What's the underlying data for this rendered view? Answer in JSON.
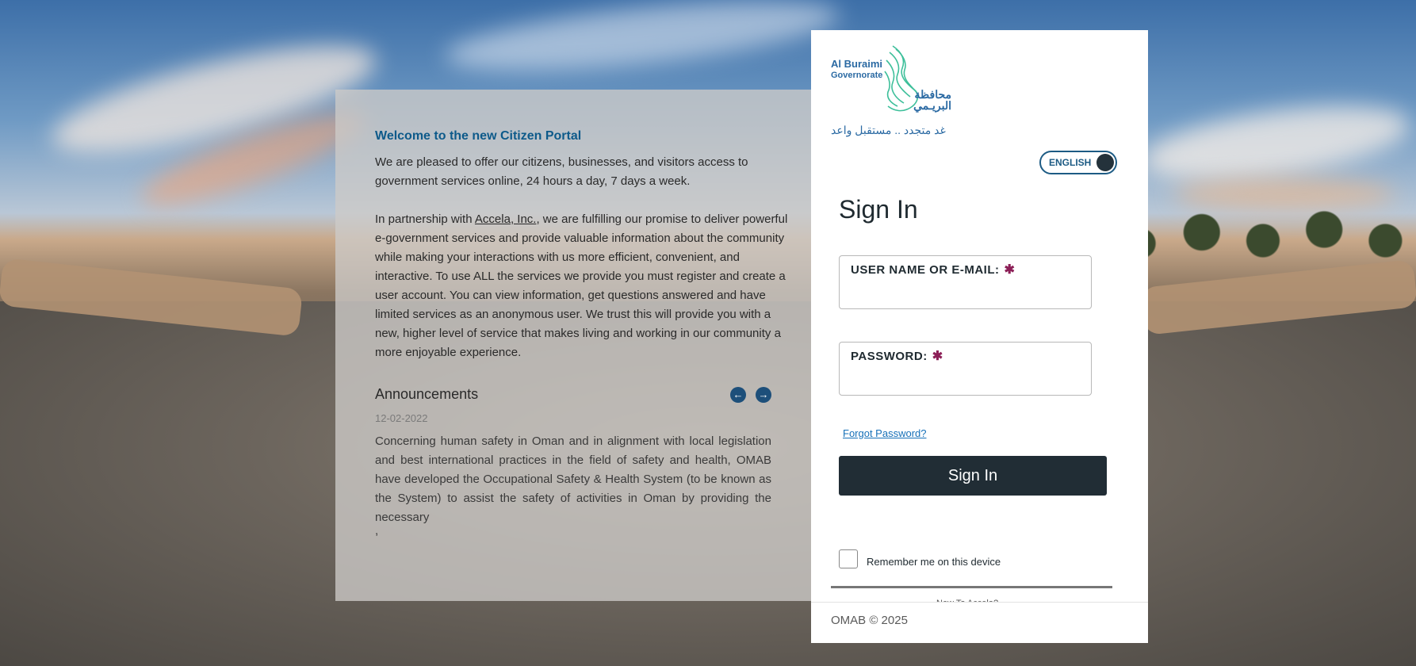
{
  "info": {
    "heading": "Welcome to the new Citizen Portal",
    "intro": "We are pleased to offer our citizens, businesses, and visitors access to government services online, 24 hours a day, 7 days a week.",
    "partnership_prefix": "In partnership with",
    "partner_link": "Accela, Inc.",
    "partnership_suffix": ", we are fulfilling our promise to deliver powerful e-government services and provide valuable information about the community while making your interactions with us more efficient, convenient, and interactive. To use ALL the services we provide you must register and create a user account. You can view information, get questions answered and have limited services as an anonymous user. We trust this will provide you with a new, higher level of service that makes living and working in our community a more enjoyable experience."
  },
  "announcements": {
    "title": "Announcements",
    "prev_icon": "arrow-left-icon",
    "next_icon": "arrow-right-icon",
    "date": "12-02-2022",
    "body": "Concerning human safety in Oman and in alignment with local legislation and best international practices in the field of safety and health, OMAB have developed the Occupational Safety & Health System (to be known as the System) to assist the safety of activities in Oman by providing the necessary",
    "trailing": ","
  },
  "logo": {
    "en_line1": "Al Buraimi",
    "en_line2": "Governorate",
    "ar_line1": "محافظة",
    "ar_line2": "البريـمي",
    "tagline": "غد متجدد .. مستقبل واعد"
  },
  "signin": {
    "language": "ENGLISH",
    "title": "Sign In",
    "username_label": "USER NAME OR E-MAIL:",
    "password_label": "PASSWORD:",
    "required_mark": "✱",
    "forgot": "Forgot Password?",
    "button": "Sign In",
    "remember": "Remember me on this device",
    "cut_text": "New To Accela?"
  },
  "footer": {
    "copyright": "OMAB © 2025"
  },
  "colors": {
    "accent": "#0d5a8a",
    "button": "#212d35",
    "required": "#8c1f57",
    "link": "#1670b8"
  }
}
